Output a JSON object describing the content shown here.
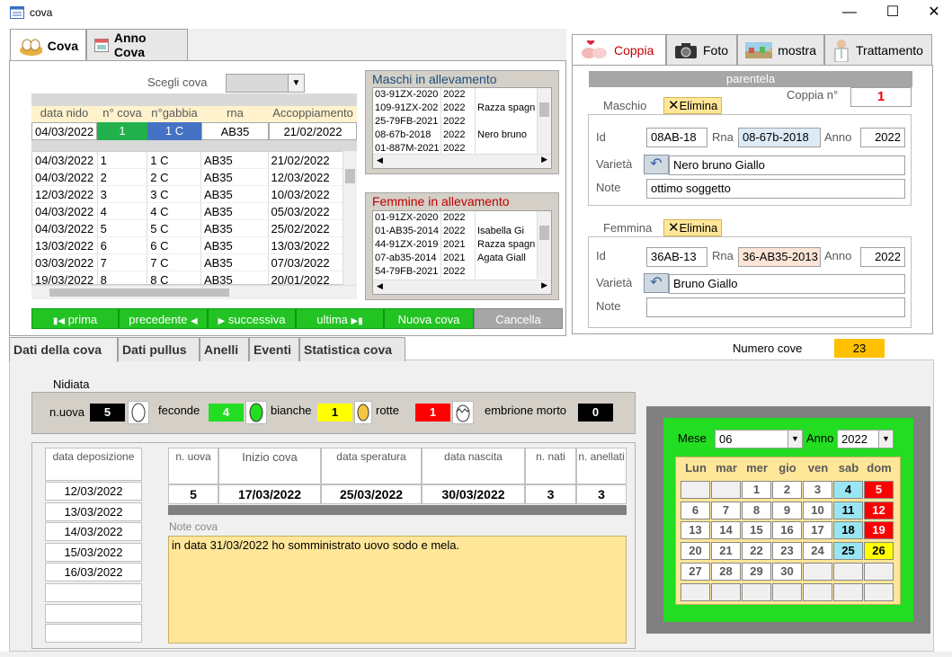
{
  "window": {
    "title": "cova"
  },
  "main_tabs": [
    "Cova",
    "Anno Cova"
  ],
  "scegli_cova_label": "Scegli cova",
  "grid": {
    "headers": [
      "data nido",
      "n° cova",
      "n°gabbia",
      "rna",
      "Accoppiamento"
    ],
    "current": [
      "04/03/2022",
      "1",
      "1 C",
      "AB35",
      "21/02/2022"
    ],
    "rows": [
      [
        "04/03/2022",
        "1",
        "1 C",
        "AB35",
        "21/02/2022"
      ],
      [
        "04/03/2022",
        "2",
        "2 C",
        "AB35",
        "12/03/2022"
      ],
      [
        "12/03/2022",
        "3",
        "3 C",
        "AB35",
        "10/03/2022"
      ],
      [
        "04/03/2022",
        "4",
        "4 C",
        "AB35",
        "05/03/2022"
      ],
      [
        "04/03/2022",
        "5",
        "5 C",
        "AB35",
        "25/02/2022"
      ],
      [
        "13/03/2022",
        "6",
        "6 C",
        "AB35",
        "13/03/2022"
      ],
      [
        "03/03/2022",
        "7",
        "7 C",
        "AB35",
        "07/03/2022"
      ],
      [
        "19/03/2022",
        "8",
        "8 C",
        "AB35",
        "20/01/2022"
      ]
    ]
  },
  "maschi": {
    "title": "Maschi in allevamento",
    "rows": [
      [
        "03-91ZX-2020",
        "2022",
        ""
      ],
      [
        "109-91ZX-202",
        "2022",
        "Razza spagn"
      ],
      [
        "25-79FB-2021",
        "2022",
        ""
      ],
      [
        "08-67b-2018",
        "2022",
        "Nero bruno"
      ],
      [
        "01-887M-2021",
        "2022",
        ""
      ]
    ]
  },
  "femmine": {
    "title": "Femmine in allevamento",
    "rows": [
      [
        "01-91ZX-2020",
        "2022",
        ""
      ],
      [
        "01-AB35-2014",
        "2022",
        "Isabella  Gi"
      ],
      [
        "44-91ZX-2019",
        "2021",
        "Razza spagn"
      ],
      [
        "07-ab35-2014",
        "2021",
        "Agata  Giall"
      ],
      [
        "54-79FB-2021",
        "2022",
        ""
      ]
    ]
  },
  "nav": {
    "first": "prima",
    "prev": "precedente",
    "next": "successiva",
    "last": "ultima",
    "new": "Nuova cova",
    "cancel": "Cancella"
  },
  "right_tabs": [
    "Coppia",
    "Foto",
    "mostra",
    "Trattamento"
  ],
  "coppia": {
    "parentela_label": "parentela",
    "coppia_n_label": "Coppia n°",
    "coppia_n": "1",
    "elimina_label": "Elimina",
    "maschio": {
      "label": "Maschio",
      "id": "08AB-18",
      "rna": "08-67b-2018",
      "anno": "2022",
      "varieta": "Nero bruno  Giallo",
      "note": "ottimo soggetto"
    },
    "femmina": {
      "label": "Femmina",
      "id": "36AB-13",
      "rna": "36-AB35-2013",
      "anno": "2022",
      "varieta": "Bruno  Giallo",
      "note": ""
    },
    "field_labels": {
      "id": "Id",
      "rna": "Rna",
      "anno": "Anno",
      "varieta": "Varietà",
      "note": "Note"
    }
  },
  "sub_tabs": [
    "Dati della cova",
    "Dati pullus",
    "Anelli",
    "Eventi",
    "Statistica cova"
  ],
  "numero_cove_label": "Numero cove",
  "numero_cove": "23",
  "nidiata": {
    "title": "Nidiata",
    "uova_label": "n.uova",
    "uova": "5",
    "feconde_label": "feconde",
    "feconde": "4",
    "bianche_label": "bianche",
    "bianche": "1",
    "rotte_label": "rotte",
    "rotte": "1",
    "morto_label": "embrione morto",
    "morto": "0"
  },
  "deposizione": {
    "header": "data deposizione",
    "dates": [
      "12/03/2022",
      "13/03/2022",
      "14/03/2022",
      "15/03/2022",
      "16/03/2022"
    ]
  },
  "riepilogo": {
    "headers": [
      "n. uova",
      "Inizio cova",
      "data speratura",
      "data nascita",
      "n. nati",
      "n. anellati"
    ],
    "values": [
      "5",
      "17/03/2022",
      "25/03/2022",
      "30/03/2022",
      "3",
      "3"
    ]
  },
  "note_cova": {
    "label": "Note cova",
    "text": "in data 31/03/2022 ho somministrato uovo sodo e mela."
  },
  "calendar": {
    "mese_label": "Mese",
    "mese": "06",
    "anno_label": "Anno",
    "anno": "2022",
    "weekdays": [
      "Lun",
      "mar",
      "mer",
      "gio",
      "ven",
      "sab",
      "dom"
    ],
    "days": [
      "",
      "",
      "1",
      "2",
      "3",
      "4",
      "5",
      "6",
      "7",
      "8",
      "9",
      "10",
      "11",
      "12",
      "13",
      "14",
      "15",
      "16",
      "17",
      "18",
      "19",
      "20",
      "21",
      "22",
      "23",
      "24",
      "25",
      "26",
      "27",
      "28",
      "29",
      "30",
      "",
      "",
      "",
      "",
      "",
      "",
      "",
      "",
      "",
      ""
    ],
    "colors": {
      "sat": "#99e6f2",
      "sun": "#ff0000",
      "today": "#ffff00",
      "bg": "#22dd22"
    }
  }
}
